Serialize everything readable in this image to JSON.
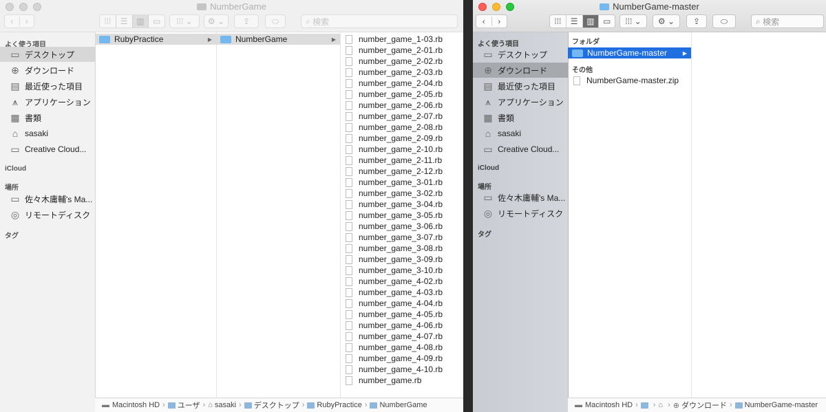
{
  "left_window": {
    "title": "NumberGame",
    "search_placeholder": "検索",
    "sidebar": {
      "favorites_header": "よく使う項目",
      "favorites": [
        {
          "label": "デスクトップ",
          "icon": "desktop-icon"
        },
        {
          "label": "ダウンロード",
          "icon": "download-icon"
        },
        {
          "label": "最近使った項目",
          "icon": "recents-icon"
        },
        {
          "label": "アプリケーション",
          "icon": "applications-icon"
        },
        {
          "label": "書類",
          "icon": "documents-icon"
        },
        {
          "label": "sasaki",
          "icon": "home-icon"
        },
        {
          "label": "Creative Cloud...",
          "icon": "folder-icon"
        }
      ],
      "icloud_header": "iCloud",
      "locations_header": "場所",
      "locations": [
        {
          "label": "佐々木庸輔's Ma...",
          "icon": "laptop-icon"
        },
        {
          "label": "リモートディスク",
          "icon": "disc-icon"
        }
      ],
      "tags_header": "タグ"
    },
    "column1": [
      "RubyPractice"
    ],
    "column2": [
      "NumberGame"
    ],
    "files": [
      "number_game_1-03.rb",
      "number_game_2-01.rb",
      "number_game_2-02.rb",
      "number_game_2-03.rb",
      "number_game_2-04.rb",
      "number_game_2-05.rb",
      "number_game_2-06.rb",
      "number_game_2-07.rb",
      "number_game_2-08.rb",
      "number_game_2-09.rb",
      "number_game_2-10.rb",
      "number_game_2-11.rb",
      "number_game_2-12.rb",
      "number_game_3-01.rb",
      "number_game_3-02.rb",
      "number_game_3-04.rb",
      "number_game_3-05.rb",
      "number_game_3-06.rb",
      "number_game_3-07.rb",
      "number_game_3-08.rb",
      "number_game_3-09.rb",
      "number_game_3-10.rb",
      "number_game_4-02.rb",
      "number_game_4-03.rb",
      "number_game_4-04.rb",
      "number_game_4-05.rb",
      "number_game_4-06.rb",
      "number_game_4-07.rb",
      "number_game_4-08.rb",
      "number_game_4-09.rb",
      "number_game_4-10.rb",
      "number_game.rb"
    ],
    "path": [
      "Macintosh HD",
      "ユーザ",
      "sasaki",
      "デスクトップ",
      "RubyPractice",
      "NumberGame"
    ]
  },
  "right_window": {
    "title": "NumberGame-master",
    "search_placeholder": "検索",
    "sidebar": {
      "favorites_header": "よく使う項目",
      "favorites": [
        {
          "label": "デスクトップ",
          "icon": "desktop-icon"
        },
        {
          "label": "ダウンロード",
          "icon": "download-icon"
        },
        {
          "label": "最近使った項目",
          "icon": "recents-icon"
        },
        {
          "label": "アプリケーション",
          "icon": "applications-icon"
        },
        {
          "label": "書類",
          "icon": "documents-icon"
        },
        {
          "label": "sasaki",
          "icon": "home-icon"
        },
        {
          "label": "Creative Cloud...",
          "icon": "folder-icon"
        }
      ],
      "icloud_header": "iCloud",
      "locations_header": "場所",
      "locations": [
        {
          "label": "佐々木庸輔's Ma...",
          "icon": "laptop-icon"
        },
        {
          "label": "リモートディスク",
          "icon": "disc-icon"
        }
      ],
      "tags_header": "タグ"
    },
    "folders_header": "フォルダ",
    "folder_item": "NumberGame-master",
    "other_header": "その他",
    "other_item": "NumberGame-master.zip",
    "path": [
      "Macintosh HD",
      "",
      "",
      "ダウンロード",
      "NumberGame-master"
    ]
  }
}
